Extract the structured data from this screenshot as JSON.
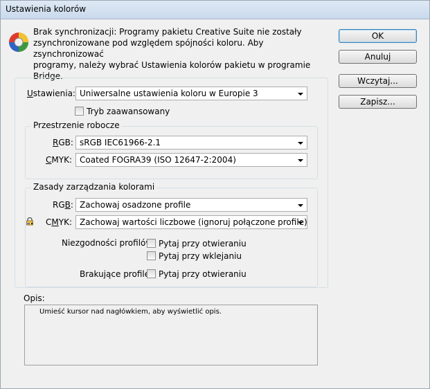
{
  "window": {
    "title": "Ustawienia kolorów"
  },
  "info": {
    "lines": [
      "Brak synchronizacji: Programy pakietu Creative Suite nie zostały",
      "zsynchronizowane pod względem spójności koloru. Aby zsynchronizować",
      "programy, należy wybrać Ustawienia kolorów pakietu w programie Bridge."
    ]
  },
  "buttons": {
    "ok": "OK",
    "cancel": "Anuluj",
    "load": "Wczytaj...",
    "save": "Zapisz..."
  },
  "settings": {
    "label_u": "U",
    "label_rest": "stawienia:",
    "value": "Uniwersalne ustawienia koloru w Europie 3",
    "advanced_label": "Tryb zaawansowany",
    "advanced_checked": false
  },
  "working_spaces": {
    "title": "Przestrzenie robocze",
    "rgb_label_u": "R",
    "rgb_label_rest": "GB:",
    "rgb_value": "sRGB IEC61966-2.1",
    "cmyk_label_u": "C",
    "cmyk_label_rest": "MYK:",
    "cmyk_value": "Coated FOGRA39 (ISO 12647-2:2004)"
  },
  "policies": {
    "title": "Zasady zarządzania kolorami",
    "rgb_label_pre": "RG",
    "rgb_label_u": "B",
    "rgb_label_post": ":",
    "rgb_value": "Zachowaj osadzone profile",
    "cmyk_label_pre": "C",
    "cmyk_label_u": "M",
    "cmyk_label_post": "YK:",
    "cmyk_value": "Zachowaj wartości liczbowe (ignoruj połączone profile)",
    "mismatch_label": "Niezgodności profilów:",
    "ask_open_label": "Pytaj przy otwieraniu",
    "ask_paste_label": "Pytaj przy wklejaniu",
    "missing_label": "Brakujące profile:",
    "missing_ask_open_label": "Pytaj przy otwieraniu"
  },
  "description": {
    "label": "Opis:",
    "text": "Umieść kursor nad nagłówkiem, aby wyświetlić opis."
  },
  "colors": {
    "titlebar": "#c9d9ec",
    "default_button_border": "#3c7fb1"
  }
}
